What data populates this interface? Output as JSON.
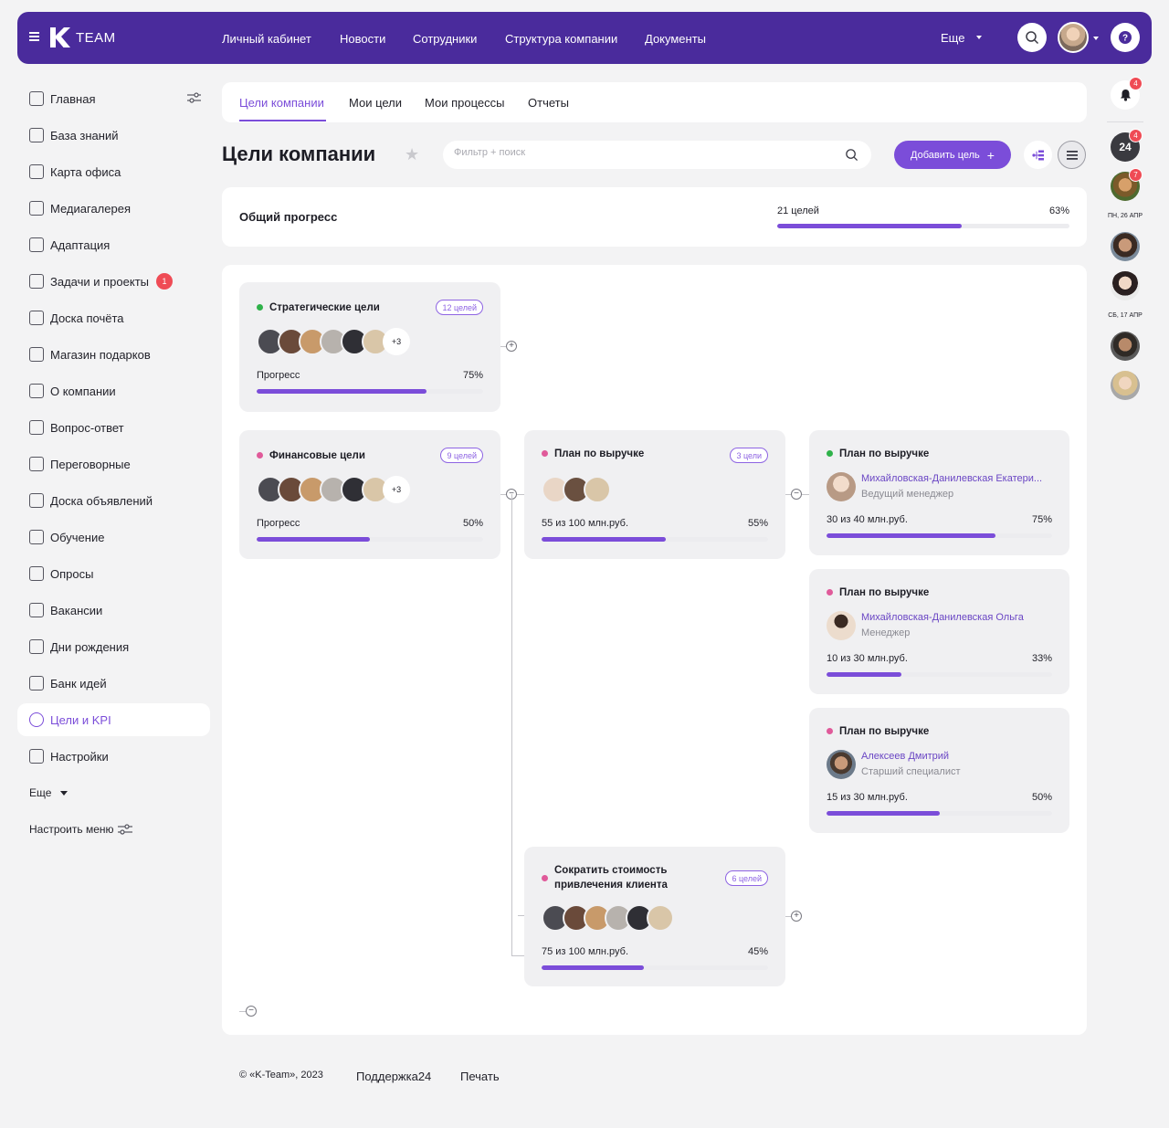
{
  "header": {
    "logo_text": "TEAM",
    "nav": [
      "Личный кабинет",
      "Новости",
      "Сотрудники",
      "Структура компании",
      "Документы"
    ],
    "more": "Еще"
  },
  "sidebar": {
    "items": [
      {
        "label": "Главная"
      },
      {
        "label": "База знаний"
      },
      {
        "label": "Карта офиса"
      },
      {
        "label": "Медиагалерея"
      },
      {
        "label": "Адаптация"
      },
      {
        "label": "Задачи и проекты",
        "badge": "1"
      },
      {
        "label": "Доска почёта"
      },
      {
        "label": "Магазин подарков"
      },
      {
        "label": "О компании"
      },
      {
        "label": "Вопрос-ответ"
      },
      {
        "label": "Переговорные"
      },
      {
        "label": "Доска объявлений"
      },
      {
        "label": "Обучение"
      },
      {
        "label": "Опросы"
      },
      {
        "label": "Вакансии"
      },
      {
        "label": "Дни рождения"
      },
      {
        "label": "Банк идей"
      },
      {
        "label": "Цели и KPI",
        "active": true
      },
      {
        "label": "Настройки"
      }
    ],
    "more": "Еще",
    "configure": "Настроить меню"
  },
  "tabs": [
    "Цели компании",
    "Мои цели",
    "Мои процессы",
    "Отчеты"
  ],
  "page": {
    "title": "Цели компании",
    "search_placeholder": "Фильтр + поиск",
    "add_button": "Добавить цель"
  },
  "overall": {
    "label": "Общий прогресс",
    "count": "21 целей",
    "percent": "63%",
    "progress": 0.63
  },
  "cards": {
    "strategic": {
      "title": "Стратегические цели",
      "chip": "12 целей",
      "more": "+3",
      "progress_label": "Прогресс",
      "percent": "75%",
      "progress": 0.75,
      "dot": "#2fb24a"
    },
    "financial": {
      "title": "Финансовые цели",
      "chip": "9 целей",
      "more": "+3",
      "progress_label": "Прогресс",
      "percent": "50%",
      "progress": 0.5,
      "dot": "#e05a9a"
    },
    "revenue": {
      "title": "План по выручке",
      "chip": "3 цели",
      "progress_label": "55 из 100 млн.руб.",
      "percent": "55%",
      "progress": 0.55,
      "dot": "#e05a9a"
    },
    "rev1": {
      "title": "План по выручке",
      "name": "Михайловская-Данилевская Екатери...",
      "role": "Ведущий менеджер",
      "progress_label": "30 из 40 млн.руб.",
      "percent": "75%",
      "progress": 0.75,
      "dot": "#2fb24a"
    },
    "rev2": {
      "title": "План по выручке",
      "name": "Михайловская-Данилевская Ольга",
      "role": "Менеджер",
      "progress_label": "10 из 30 млн.руб.",
      "percent": "33%",
      "progress": 0.33,
      "dot": "#e05a9a"
    },
    "rev3": {
      "title": "План по выручке",
      "name": "Алексеев Дмитрий",
      "role": "Старший специалист",
      "progress_label": "15 из 30 млн.руб.",
      "percent": "50%",
      "progress": 0.5,
      "dot": "#e05a9a"
    },
    "cost": {
      "title_line1": "Сократить стоимость",
      "title_line2": "привлечения клиента",
      "chip": "6 целей",
      "progress_label": "75 из 100 млн.руб.",
      "percent": "45%",
      "progress": 0.45,
      "dot": "#e05a9a"
    }
  },
  "rail": {
    "bell_badge": "4",
    "b24_badge": "4",
    "user_badge": "7",
    "date1": "ПН, 26 АПР",
    "date2": "СБ, 17 АПР"
  },
  "footer": {
    "copyright": "© «K-Team», 2023",
    "support": "Поддержка24",
    "print": "Печать"
  },
  "colors": {
    "brand": "#4a2b9c",
    "accent": "#7b4dd9",
    "badge": "#ef4b55"
  }
}
